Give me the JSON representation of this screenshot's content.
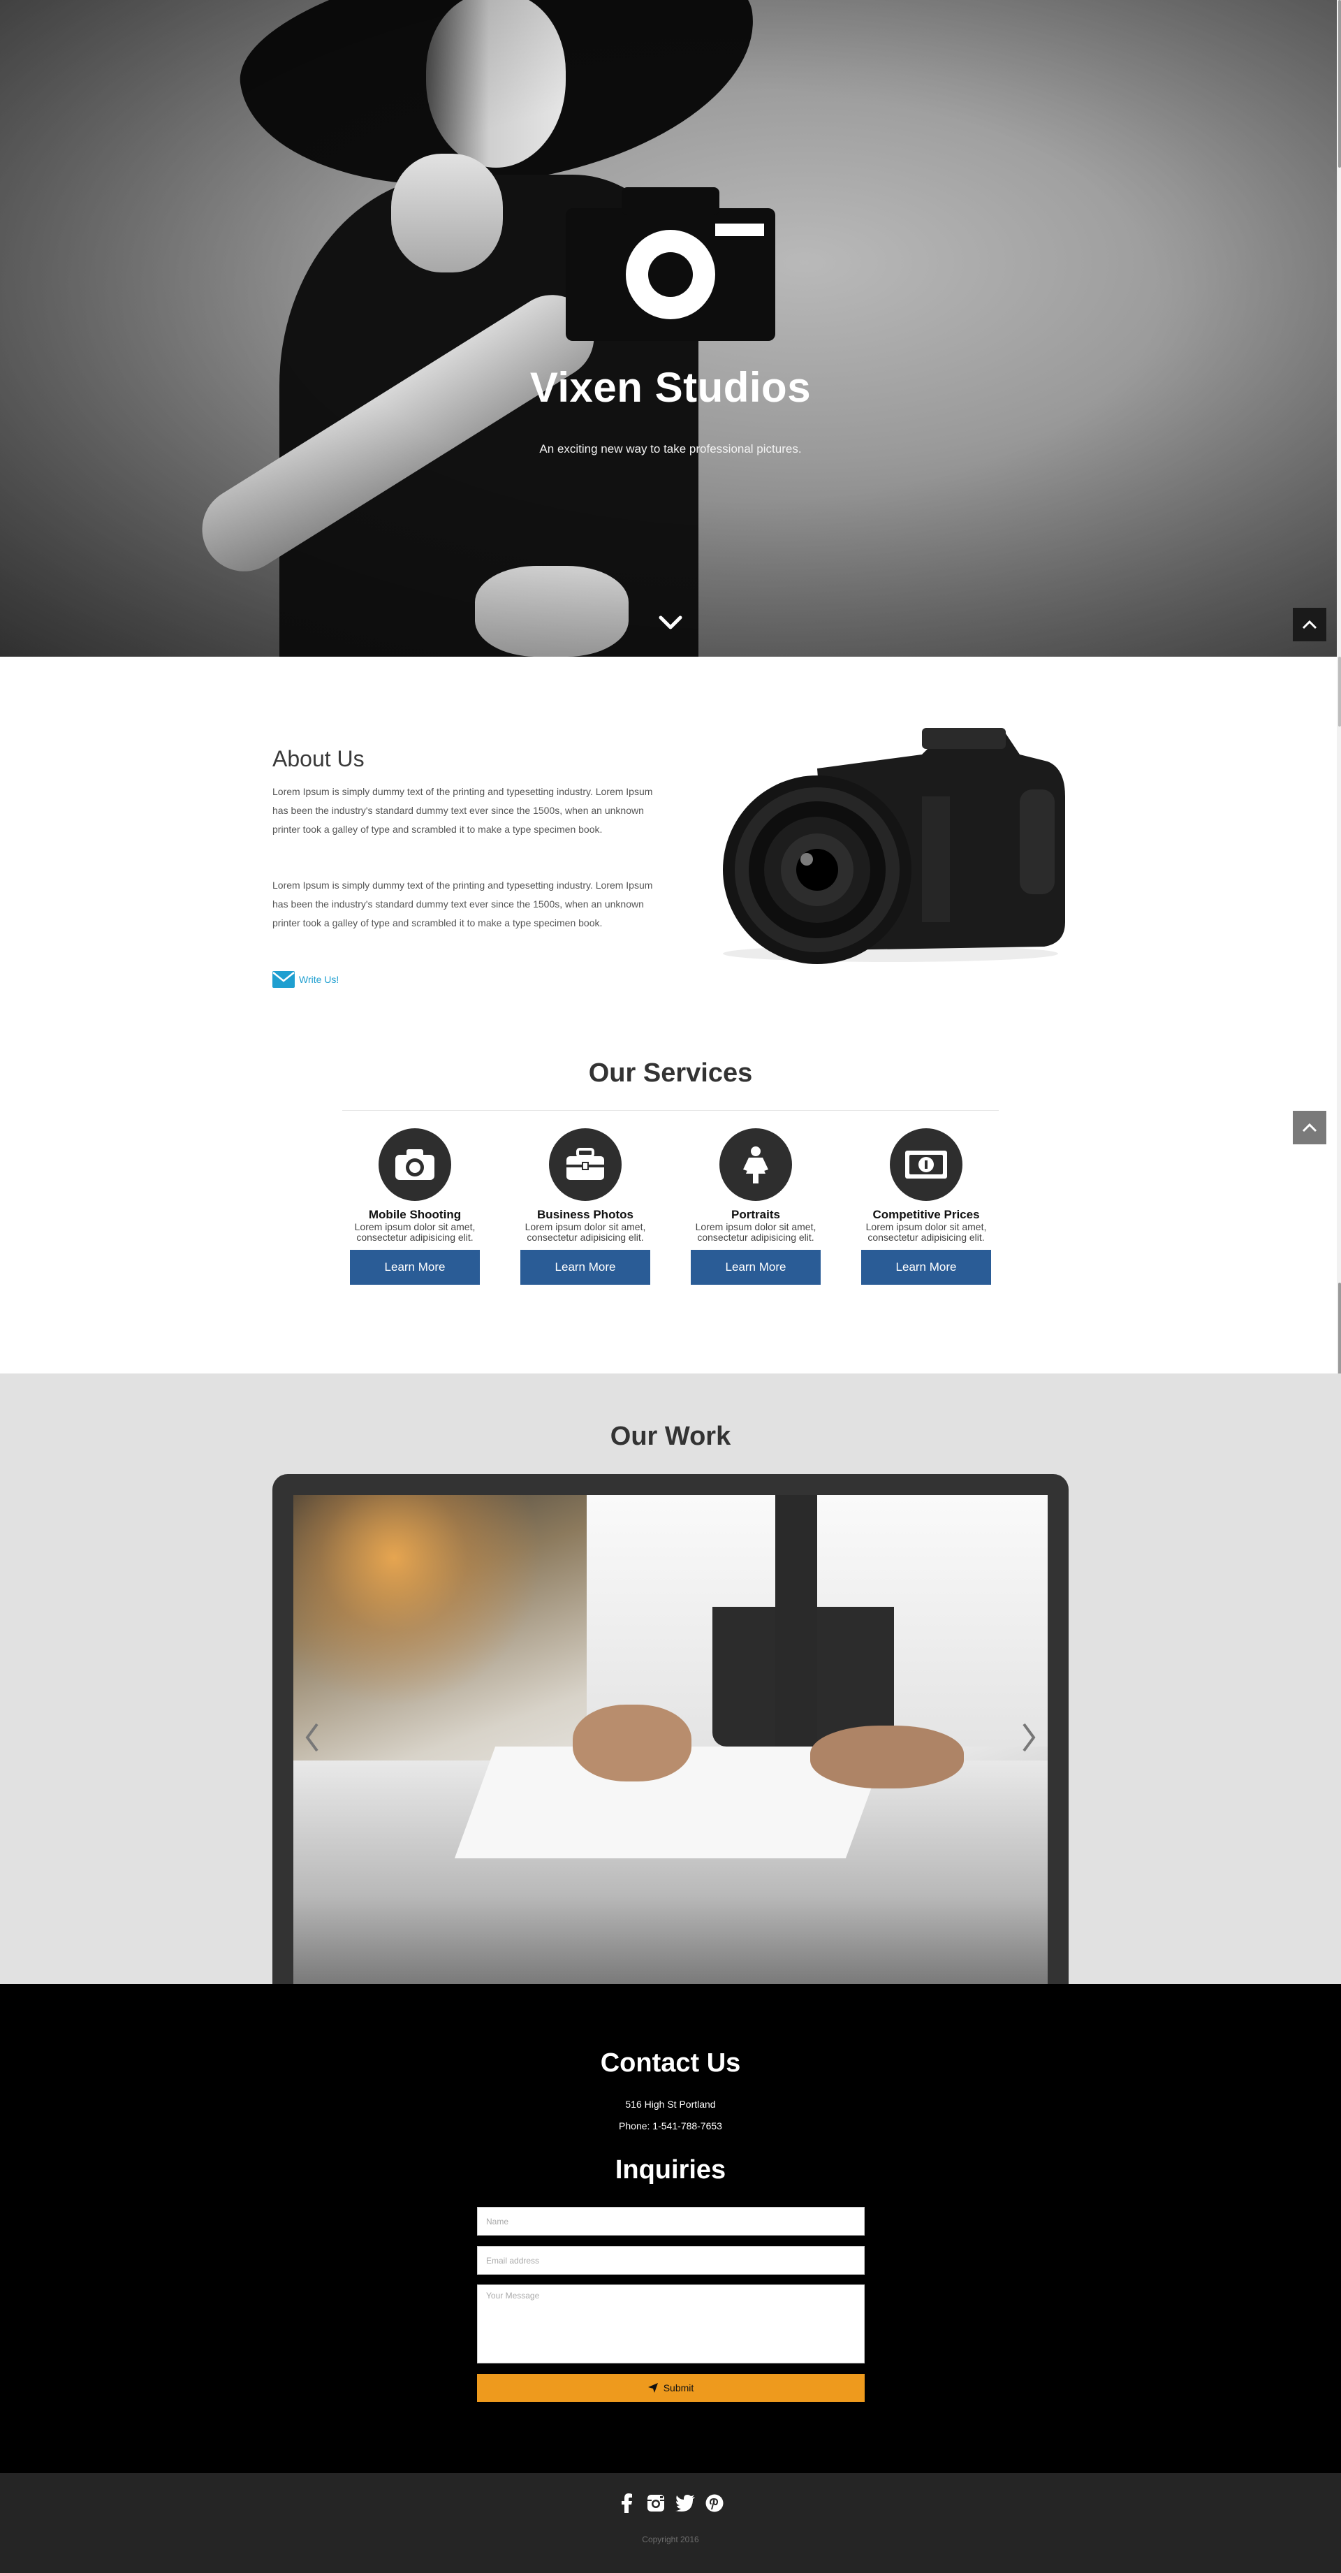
{
  "hero": {
    "title": "Vixen Studios",
    "subtitle": "An exciting new way to take professional pictures."
  },
  "about": {
    "title": "About Us",
    "paragraph_1": "Lorem Ipsum is simply dummy text of the printing and typesetting industry. Lorem Ipsum has been the industry's standard dummy text ever since the 1500s, when an unknown printer took a galley of type and scrambled it to make a type specimen book.",
    "paragraph_2": "Lorem Ipsum is simply dummy text of the printing and typesetting industry. Lorem Ipsum has been the industry's standard dummy text ever since the 1500s, when an unknown printer took a galley of type and scrambled it to make a type specimen book.",
    "write_us": "Write Us!"
  },
  "services": {
    "title": "Our Services",
    "items": [
      {
        "name": "Mobile Shooting",
        "desc": "Lorem ipsum dolor sit amet, consectetur adipisicing elit.",
        "button": "Learn More",
        "icon": "camera-icon"
      },
      {
        "name": "Business Photos",
        "desc": "Lorem ipsum dolor sit amet, consectetur adipisicing elit.",
        "button": "Learn More",
        "icon": "briefcase-icon"
      },
      {
        "name": "Portraits",
        "desc": "Lorem ipsum dolor sit amet, consectetur adipisicing elit.",
        "button": "Learn More",
        "icon": "person-icon"
      },
      {
        "name": "Competitive Prices",
        "desc": "Lorem ipsum dolor sit amet, consectetur adipisicing elit.",
        "button": "Learn More",
        "icon": "money-icon"
      }
    ]
  },
  "work": {
    "title": "Our Work"
  },
  "contact": {
    "title": "Contact Us",
    "address": "516 High St Portland",
    "phone": "Phone: 1-541-788-7653",
    "inquiries_title": "Inquiries",
    "name_placeholder": "Name",
    "email_placeholder": "Email address",
    "message_placeholder": "Your Message",
    "submit": "Submit"
  },
  "footer": {
    "socials": [
      "facebook-icon",
      "instagram-icon",
      "twitter-icon",
      "pinterest-icon"
    ],
    "copyright": "Copyright 2016"
  },
  "colors": {
    "button_blue": "#2a5c96",
    "submit_orange": "#ee9a1d",
    "link_blue": "#1f9fd0",
    "footer_bg": "#252525"
  }
}
